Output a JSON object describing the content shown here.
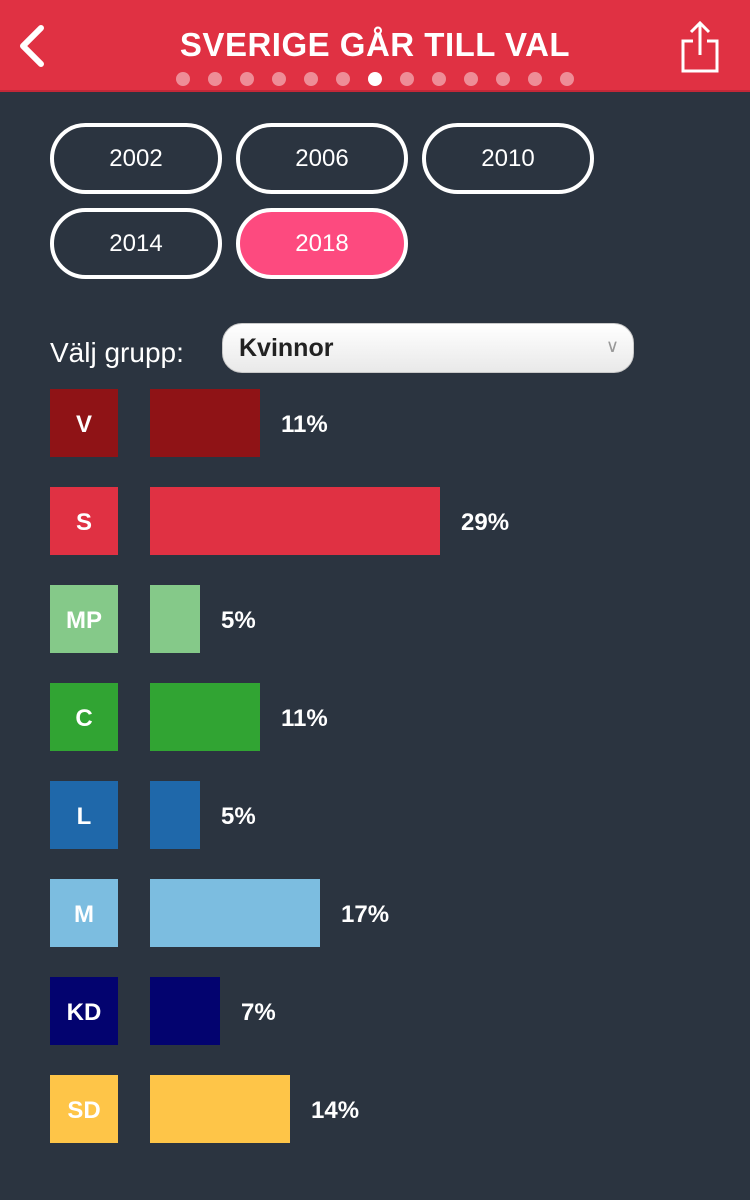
{
  "header": {
    "title": "SVERIGE GÅR TILL VAL",
    "back_icon": "chevron-left-icon",
    "share_icon": "share-icon",
    "page_dots": 13,
    "active_dot": 6
  },
  "years": [
    {
      "label": "2002",
      "selected": false
    },
    {
      "label": "2006",
      "selected": false
    },
    {
      "label": "2010",
      "selected": false
    },
    {
      "label": "2014",
      "selected": false
    },
    {
      "label": "2018",
      "selected": true
    }
  ],
  "group": {
    "label": "Välj grupp:",
    "value": "Kvinnor",
    "arrow": "∨"
  },
  "colors": {
    "header": "#e03143",
    "background": "#2b3440",
    "selected_year": "#fd4a7f"
  },
  "chart_data": {
    "type": "bar",
    "categories": [
      "V",
      "S",
      "MP",
      "C",
      "L",
      "M",
      "KD",
      "SD"
    ],
    "values": [
      11,
      29,
      5,
      11,
      5,
      17,
      7,
      14
    ],
    "labels": [
      "11%",
      "29%",
      "5%",
      "11%",
      "5%",
      "17%",
      "7%",
      "14%"
    ],
    "colors": [
      "#8f1316",
      "#e03143",
      "#85c989",
      "#31a433",
      "#1f68aa",
      "#7cbde0",
      "#03036f",
      "#fec548"
    ],
    "title": "",
    "xlabel": "",
    "ylabel": "",
    "orientation": "horizontal",
    "grid": false
  }
}
